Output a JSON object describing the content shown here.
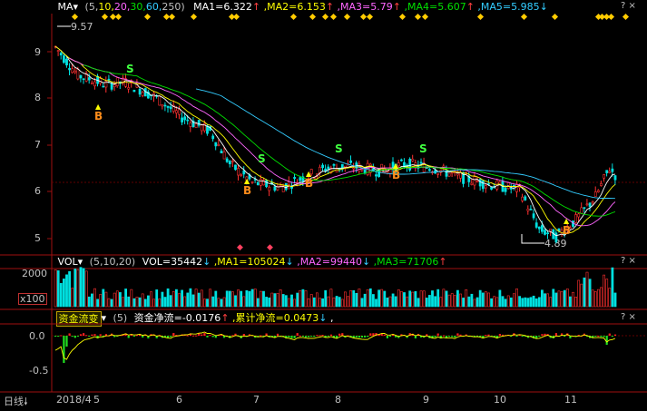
{
  "price_header": {
    "ma_label": "MA",
    "params_open": "(5,",
    "p10": "10,",
    "p20": "20,",
    "p30": "30,",
    "p60": "60,",
    "p250": "250)",
    "ma1": "MA1=6.322",
    "ma2": ",MA2=6.153",
    "ma3": ",MA3=5.79",
    "ma4": ",MA4=5.607",
    "ma5": ",MA5=5.985"
  },
  "price_axis": [
    "9",
    "8",
    "7",
    "6",
    "5"
  ],
  "price_annotations": {
    "high": "9.57",
    "low": "4.89",
    "buy": "B",
    "sell": "S"
  },
  "vol_header": {
    "name": "VOL",
    "params": "(5,10,20)",
    "vol": "VOL=35442",
    "ma1": ",MA1=105024",
    "ma2": ",MA2=99440",
    "ma3": ",MA3=71706"
  },
  "vol_axis": {
    "top": "2000",
    "unit": "x100"
  },
  "flow_header": {
    "tag": "资金流变",
    "params": "(5)",
    "net": "资金净流=-0.0176",
    "cum": ",累计净流=0.0473",
    "tail": ","
  },
  "flow_axis": [
    "0.0",
    "-0.5"
  ],
  "x_axis": {
    "period": "日线",
    "labels": [
      "2018/4",
      "5",
      "6",
      "7",
      "8",
      "9",
      "10",
      "11"
    ]
  },
  "colors": {
    "up": "#ff3030",
    "down": "#00e0e0",
    "ma5": "#ffffff",
    "ma10": "#ffff00",
    "ma20": "#ff66ff",
    "ma30": "#00e000",
    "ma60": "#33ccff"
  }
}
